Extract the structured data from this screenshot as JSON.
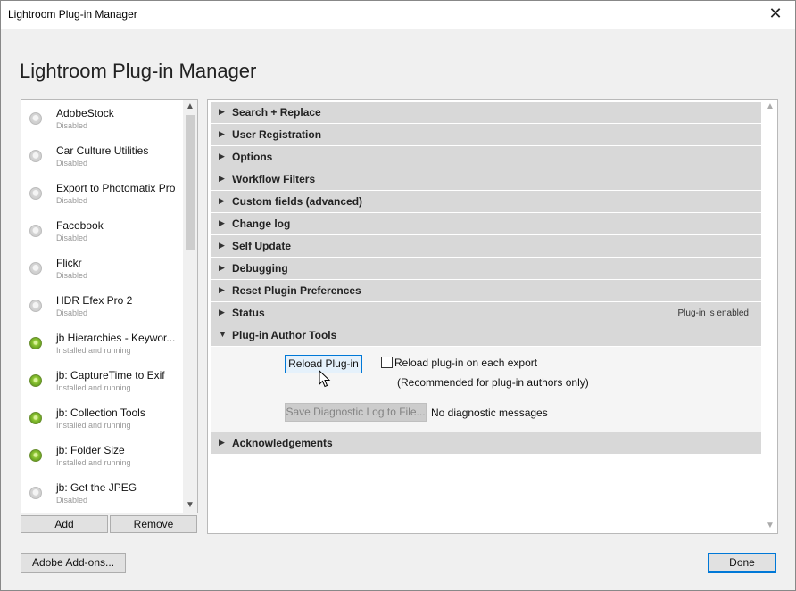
{
  "window": {
    "title": "Lightroom Plug-in Manager",
    "close_glyph": "✕"
  },
  "heading": "Lightroom Plug-in Manager",
  "plugins": [
    {
      "name": "AdobeStock",
      "status": "Disabled",
      "enabled": false
    },
    {
      "name": "Car Culture Utilities",
      "status": "Disabled",
      "enabled": false
    },
    {
      "name": "Export to Photomatix Pro",
      "status": "Disabled",
      "enabled": false
    },
    {
      "name": "Facebook",
      "status": "Disabled",
      "enabled": false
    },
    {
      "name": "Flickr",
      "status": "Disabled",
      "enabled": false
    },
    {
      "name": "HDR Efex Pro 2",
      "status": "Disabled",
      "enabled": false
    },
    {
      "name": "jb Hierarchies - Keywor...",
      "status": "Installed and running",
      "enabled": true
    },
    {
      "name": "jb: CaptureTime to Exif",
      "status": "Installed and running",
      "enabled": true
    },
    {
      "name": "jb: Collection Tools",
      "status": "Installed and running",
      "enabled": true
    },
    {
      "name": "jb: Folder Size",
      "status": "Installed and running",
      "enabled": true
    },
    {
      "name": "jb: Get the JPEG",
      "status": "Disabled",
      "enabled": false
    }
  ],
  "list_buttons": {
    "add": "Add",
    "remove": "Remove"
  },
  "sections": {
    "search_replace": "Search + Replace",
    "user_registration": "User Registration",
    "options": "Options",
    "workflow_filters": "Workflow Filters",
    "custom_fields": "Custom fields (advanced)",
    "change_log": "Change log",
    "self_update": "Self Update",
    "debugging": "Debugging",
    "reset_prefs": "Reset Plugin Preferences",
    "status": "Status",
    "status_value": "Plug-in is enabled",
    "author_tools": "Plug-in Author Tools",
    "acknowledgements": "Acknowledgements"
  },
  "author_tools": {
    "reload_button": "Reload Plug-in",
    "reload_checkbox_label": "Reload plug-in on each export",
    "reload_note": "(Recommended for plug-in authors only)",
    "diagnostic_button": "Save Diagnostic Log to File...",
    "diagnostic_message": "No diagnostic messages"
  },
  "footer": {
    "addons": "Adobe Add-ons...",
    "done": "Done"
  },
  "icons": {
    "collapsed_arrow": "▶",
    "expanded_arrow": "▼",
    "scroll_up": "▲",
    "scroll_down": "▼"
  }
}
